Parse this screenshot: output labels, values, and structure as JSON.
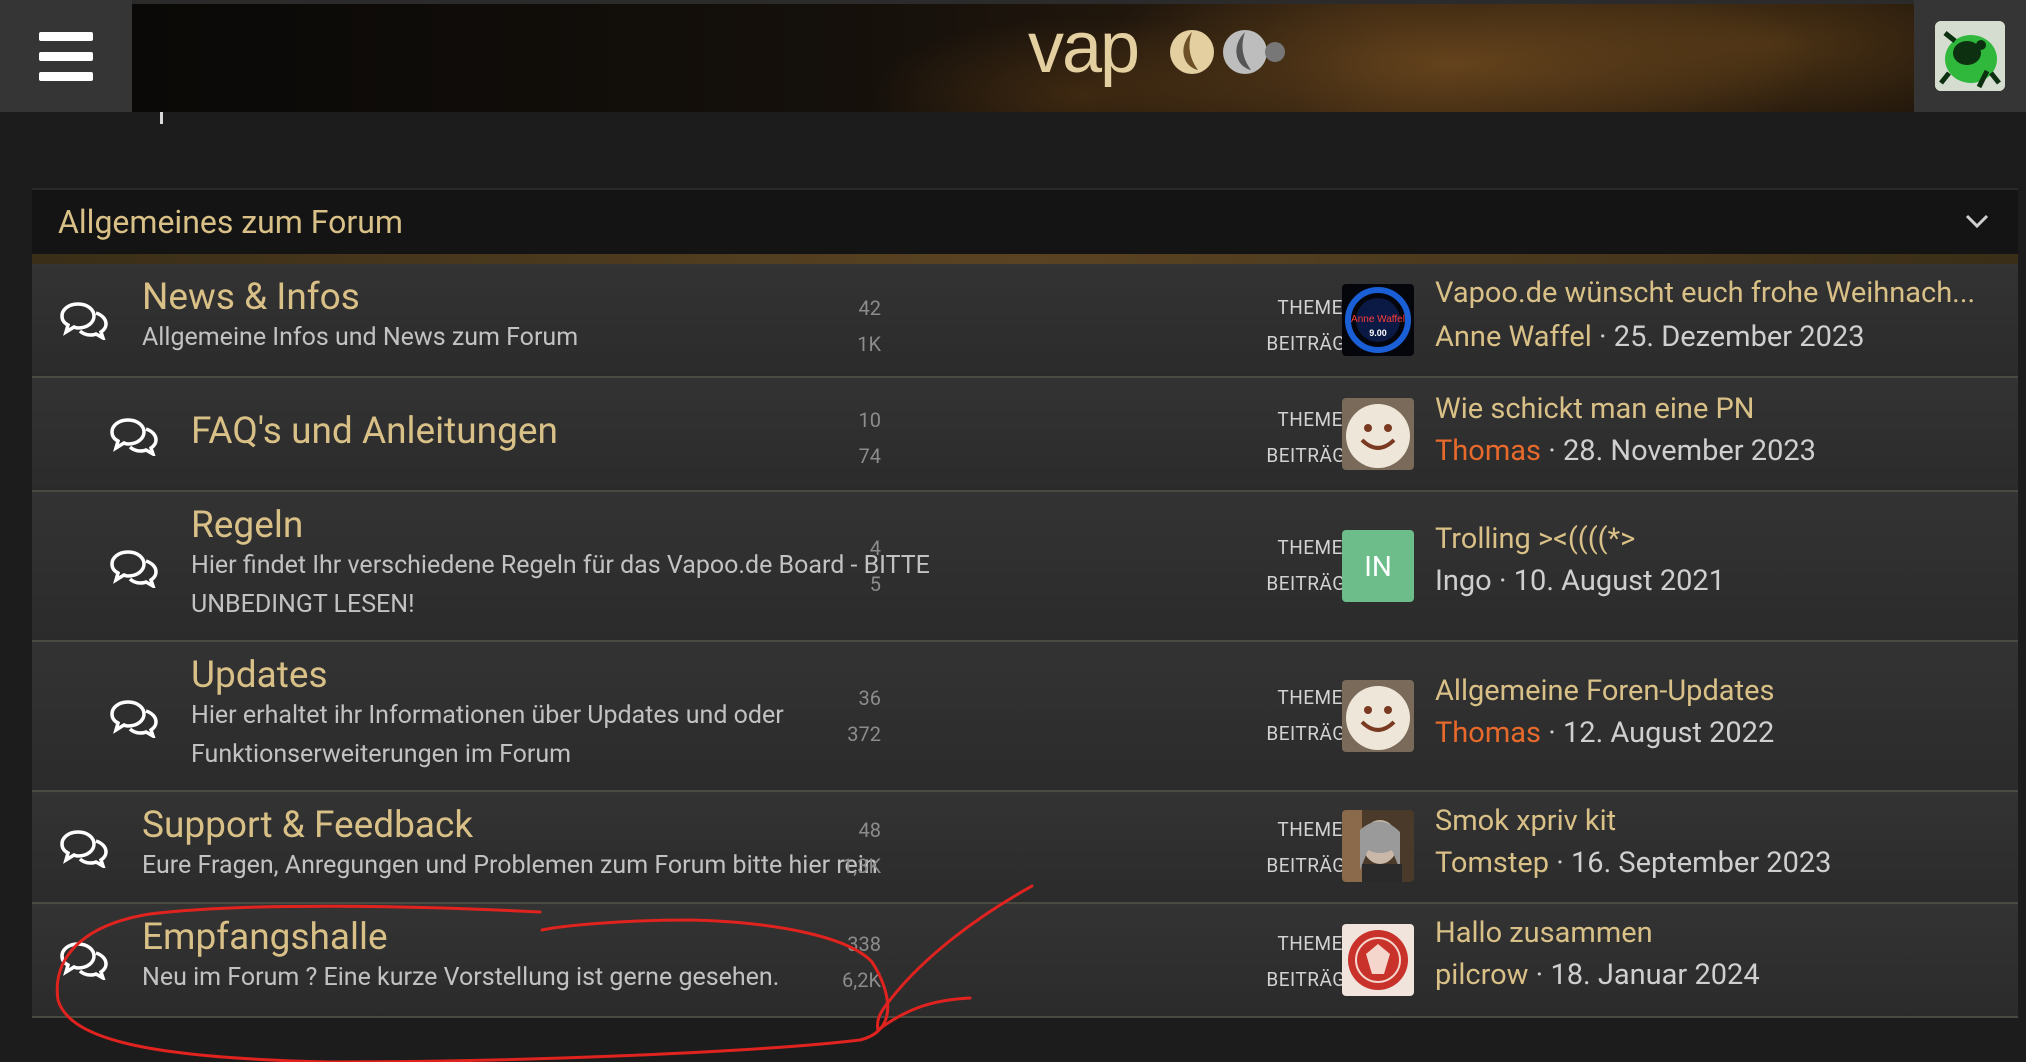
{
  "header": {
    "menu_label": "menu",
    "logo_text": "vapoo",
    "menu_icon": "hamburger-icon",
    "avatar_icon": "frog-avatar"
  },
  "category": {
    "title": "Allgemeines zum Forum",
    "toggle_icon": "chevron-down-icon"
  },
  "nodes": [
    {
      "title": "News & Infos",
      "desc": "Allgemeine Infos und News zum Forum",
      "threads": "42",
      "posts": "1K",
      "threads_label": "THEMEN",
      "posts_label": "BEITRÄGE",
      "last_title": "Vapoo.de wünscht euch frohe Weihnach...",
      "last_user": "Anne Waffel",
      "last_date": "25. Dezember 2023",
      "avatar_text": "Anne Waffel"
    },
    {
      "title": "FAQ's und Anleitungen",
      "desc": "",
      "threads": "10",
      "posts": "74",
      "threads_label": "THEMEN",
      "posts_label": "BEITRÄGE",
      "last_title": "Wie schickt man eine PN",
      "last_user": "Thomas",
      "last_date": "28. November 2023"
    },
    {
      "title": "Regeln",
      "desc": "Hier findet Ihr verschiedene Regeln für das Vapoo.de Board - BITTE UNBEDINGT LESEN!",
      "threads": "4",
      "posts": "5",
      "threads_label": "THEMEN",
      "posts_label": "BEITRÄGE",
      "last_title": "Trolling ><((((*>",
      "last_user": "Ingo",
      "last_date": "10. August 2021",
      "avatar_text": "IN"
    },
    {
      "title": "Updates",
      "desc": "Hier erhaltet ihr Informationen über Updates und oder Funktionserweiterungen im Forum",
      "threads": "36",
      "posts": "372",
      "threads_label": "THEMEN",
      "posts_label": "BEITRÄGE",
      "last_title": "Allgemeine Foren-Updates",
      "last_user": "Thomas",
      "last_date": "12. August 2022"
    },
    {
      "title": "Support & Feedback",
      "desc": "Eure Fragen, Anregungen und Problemen zum Forum bitte hier rein",
      "threads": "48",
      "posts": "1,3K",
      "threads_label": "THEMEN",
      "posts_label": "BEITRÄGE",
      "last_title": "Smok xpriv kit",
      "last_user": "Tomstep",
      "last_date": "16. September 2023"
    },
    {
      "title": "Empfangshalle",
      "desc": "Neu im Forum ? Eine kurze Vorstellung ist gerne gesehen.",
      "threads": "338",
      "posts": "6,2K",
      "threads_label": "THEMEN",
      "posts_label": "BEITRÄGE",
      "last_title": "Hallo zusammen",
      "last_user": "pilcrow",
      "last_date": "18. Januar 2024"
    }
  ],
  "meta_separator": "·",
  "colors": {
    "accent": "#d9c087",
    "staff_user": "#e76a2c",
    "annotation": "#e0231f"
  }
}
